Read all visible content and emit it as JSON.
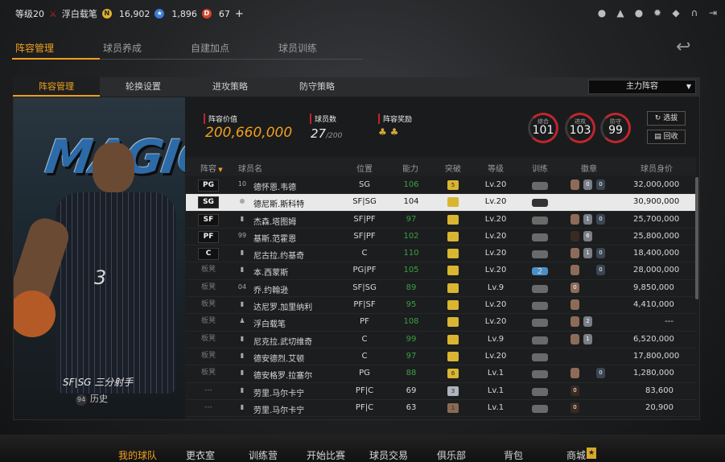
{
  "topbar": {
    "level": "等级20",
    "username": "浮白载笔",
    "currency1": "16,902",
    "currency2": "1,896",
    "currency3": "67",
    "add": "+"
  },
  "topicons": [
    "user-icon",
    "bell-icon",
    "friends-icon",
    "gear-icon",
    "shield-icon",
    "headset-icon",
    "exit-icon"
  ],
  "tabs1": [
    "阵容管理",
    "球员养成",
    "自建加点",
    "球员训练"
  ],
  "tabs2": [
    "阵容管理",
    "轮换设置",
    "进攻策略",
    "防守策略"
  ],
  "lineup_select": "主力阵容",
  "player_card": {
    "logo_text": "MAGIC",
    "role": "SF|SG 三分射手",
    "history_num": "94",
    "history_label": "历史"
  },
  "stats": {
    "value_label": "阵容价值",
    "value": "200,660,000",
    "count_label": "球员数",
    "count": "27",
    "count_max": "/200",
    "reward_label": "阵容奖励"
  },
  "rings": [
    {
      "label": "综合",
      "value": "101"
    },
    {
      "label": "进攻",
      "value": "103"
    },
    {
      "label": "防守",
      "value": "99"
    }
  ],
  "buttons": {
    "select": "选拔",
    "recycle": "回收"
  },
  "headers": {
    "lineup": "阵容",
    "name": "球员名",
    "pos": "位置",
    "ability": "能力",
    "breakthrough": "突破",
    "level": "等级",
    "train": "训练",
    "badge": "徽章",
    "price": "球员身价"
  },
  "rows": [
    {
      "slot": "PG",
      "num": "10",
      "name": "德怀恩.韦德",
      "pos": "SG",
      "ability": "106",
      "brk": "5",
      "lv": "Lv.20",
      "badges": [
        "",
        "0",
        "0"
      ],
      "price": "32,000,000"
    },
    {
      "slot": "SG",
      "num": "",
      "name": "德尼斯.斯科特",
      "pos": "SF|SG",
      "ability": "104",
      "brk": "",
      "lv": "Lv.20",
      "badges": [],
      "price": "30,900,000"
    },
    {
      "slot": "SF",
      "num": "",
      "name": "杰森.塔图姆",
      "pos": "SF|PF",
      "ability": "97",
      "brk": "",
      "lv": "Lv.20",
      "badges": [
        "",
        "1",
        "0"
      ],
      "price": "25,700,000"
    },
    {
      "slot": "PF",
      "num": "99",
      "name": "基斯.范霍恩",
      "pos": "SF|PF",
      "ability": "102",
      "brk": "",
      "lv": "Lv.20",
      "badges": [
        "",
        "6"
      ],
      "price": "25,800,000"
    },
    {
      "slot": "C",
      "num": "",
      "name": "尼古拉.约基奇",
      "pos": "C",
      "ability": "110",
      "brk": "",
      "lv": "Lv.20",
      "badges": [
        "",
        "1",
        "0"
      ],
      "price": "18,400,000"
    },
    {
      "slot": "板凳",
      "num": "",
      "name": "本.西蒙斯",
      "pos": "PG|PF",
      "ability": "105",
      "brk": "",
      "lv": "Lv.20",
      "badges": [
        "2",
        "",
        "0"
      ],
      "price": "28,000,000"
    },
    {
      "slot": "板凳",
      "num": "04",
      "name": "乔.约翰逊",
      "pos": "SF|SG",
      "ability": "89",
      "brk": "",
      "lv": "Lv.9",
      "badges": [
        "0"
      ],
      "price": "9,850,000"
    },
    {
      "slot": "板凳",
      "num": "",
      "name": "达尼罗.加里纳利",
      "pos": "PF|SF",
      "ability": "95",
      "brk": "",
      "lv": "Lv.20",
      "badges": [
        ""
      ],
      "price": "4,410,000"
    },
    {
      "slot": "板凳",
      "num": "",
      "name": "浮白载笔",
      "pos": "PF",
      "ability": "108",
      "brk": "",
      "lv": "Lv.20",
      "badges": [
        "",
        "2"
      ],
      "price": "---"
    },
    {
      "slot": "板凳",
      "num": "",
      "name": "尼克拉.武切维奇",
      "pos": "C",
      "ability": "99",
      "brk": "",
      "lv": "Lv.9",
      "badges": [
        "",
        "1"
      ],
      "price": "6,520,000"
    },
    {
      "slot": "板凳",
      "num": "",
      "name": "德安德烈.艾顿",
      "pos": "C",
      "ability": "97",
      "brk": "",
      "lv": "Lv.20",
      "badges": [],
      "price": "17,800,000"
    },
    {
      "slot": "板凳",
      "num": "",
      "name": "德安格罗.拉塞尔",
      "pos": "PG",
      "ability": "88",
      "brk": "6",
      "lv": "Lv.1",
      "badges": [
        "",
        "",
        "0"
      ],
      "price": "1,280,000"
    },
    {
      "slot": "---",
      "num": "",
      "name": "劳里.马尔卡宁",
      "pos": "PF|C",
      "ability": "69",
      "brk": "3",
      "lv": "Lv.1",
      "badges": [
        "0"
      ],
      "price": "83,600"
    },
    {
      "slot": "---",
      "num": "",
      "name": "劳里.马尔卡宁",
      "pos": "PF|C",
      "ability": "63",
      "brk": "1",
      "lv": "Lv.1",
      "badges": [
        "0"
      ],
      "price": "20,900"
    }
  ],
  "bottom_nav": [
    "我的球队",
    "更衣室",
    "训练营",
    "开始比赛",
    "球员交易",
    "俱乐部",
    "背包",
    "商城"
  ]
}
